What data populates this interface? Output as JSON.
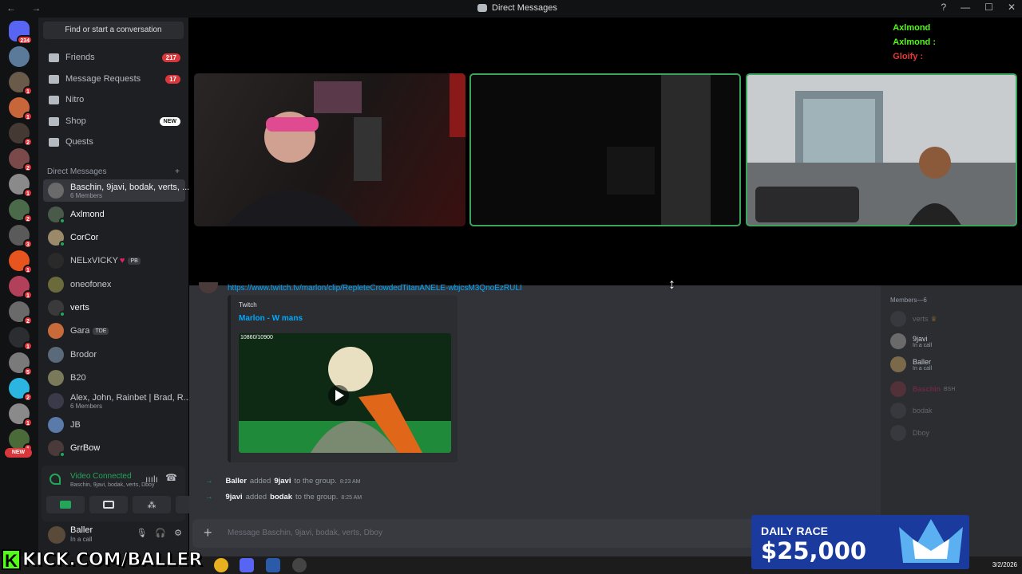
{
  "window": {
    "title": "Direct Messages",
    "nav": "← →",
    "controls": [
      "—",
      "☐",
      "✕"
    ]
  },
  "rail": {
    "home_badge": "234",
    "badges": [
      "1",
      "1",
      "2",
      "2",
      "1",
      "2",
      "3",
      "1",
      "1",
      "2",
      "1",
      "1",
      "1",
      "5",
      "2",
      "1",
      "1"
    ],
    "new_label": "NEW"
  },
  "sidebar": {
    "search_placeholder": "Find or start a conversation",
    "nav": [
      {
        "label": "Friends",
        "count": "217"
      },
      {
        "label": "Message Requests",
        "count": "17"
      },
      {
        "label": "Nitro",
        "count": ""
      },
      {
        "label": "Shop",
        "new": "NEW"
      },
      {
        "label": "Quests",
        "count": ""
      }
    ],
    "dm_header": "Direct Messages",
    "dm_add": "+",
    "dms": [
      {
        "name": "Baschin, 9javi, bodak, verts, ...",
        "sub": "6 Members",
        "active": true
      },
      {
        "name": "Axlmond"
      },
      {
        "name": "CorCor"
      },
      {
        "name": "NELxVICKY",
        "tag": "PB"
      },
      {
        "name": "oneofonex"
      },
      {
        "name": "verts"
      },
      {
        "name": "Gara",
        "tag": "TDE"
      },
      {
        "name": "Brodor"
      },
      {
        "name": "B20"
      },
      {
        "name": "Alex, John, Rainbet | Brad, R...",
        "sub": "6 Members"
      },
      {
        "name": "JB"
      },
      {
        "name": "GrrBow"
      }
    ]
  },
  "voice": {
    "status": "Video Connected",
    "channel": "Baschin, 9javi, bodak, verts, Dboy"
  },
  "user": {
    "name": "Baller",
    "status": "In a call"
  },
  "overlay_chat": [
    {
      "name": "Axlmond",
      "color": "#53fc18"
    },
    {
      "name": "Axlmond :",
      "color": "#53fc18"
    },
    {
      "name": "Gloify :",
      "color": "#e53935"
    }
  ],
  "chat": {
    "link": "https://www.twitch.tv/marlon/clip/RepleteCrowdedTitanANELE-wbjcsM3QnoEzRULI",
    "embed": {
      "provider": "Twitch",
      "title": "Marlon - W mans",
      "counter": "10860/10900"
    },
    "system": [
      {
        "actor": "Baller",
        "verb": "added",
        "target": "9javi",
        "rest": "to the group.",
        "time": "8:23 AM"
      },
      {
        "actor": "9javi",
        "verb": "added",
        "target": "bodak",
        "rest": "to the group.",
        "time": "8:25 AM"
      }
    ],
    "input_placeholder": "Message Baschin, 9javi, bodak, verts, Dboy"
  },
  "members": {
    "header": "Members—6",
    "list": [
      {
        "name": "verts",
        "sub": "",
        "dim": true
      },
      {
        "name": "9javi",
        "sub": "In a call",
        "dim": false
      },
      {
        "name": "Baller",
        "sub": "In a call",
        "dim": false
      },
      {
        "name": "Baschin",
        "sub": "",
        "dim": true,
        "tag": "BSH"
      },
      {
        "name": "bodak",
        "sub": "",
        "dim": true
      },
      {
        "name": "Dboy",
        "sub": "",
        "dim": true
      }
    ]
  },
  "overlay": {
    "kick_text": "KICK.COM/BALLER",
    "race_title": "DAILY RACE",
    "race_amount": "$25,000",
    "date": "3/2/2026"
  }
}
